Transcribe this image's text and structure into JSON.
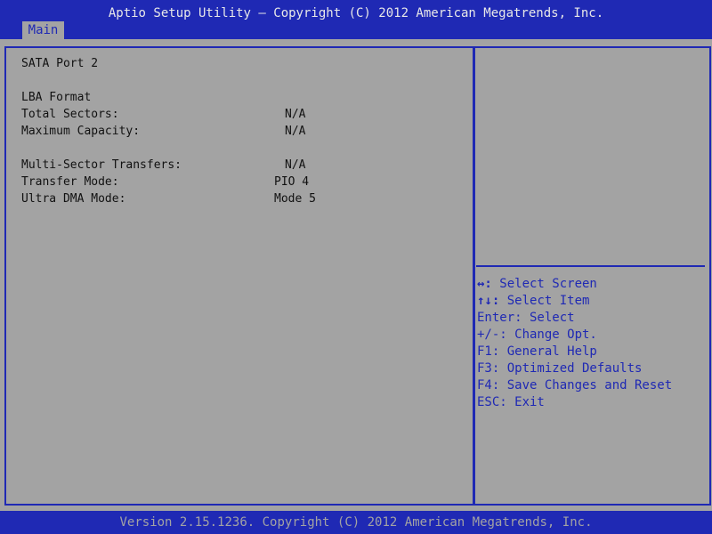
{
  "header": {
    "title": "Aptio Setup Utility – Copyright (C) 2012 American Megatrends, Inc.",
    "tabs": [
      {
        "label": "Main"
      }
    ]
  },
  "main": {
    "section_title": "SATA Port 2",
    "subsection_title": "LBA Format",
    "items": [
      {
        "label": "Total Sectors:",
        "value": "N/A"
      },
      {
        "label": "Maximum Capacity:",
        "value": "N/A"
      },
      {
        "label": "Multi-Sector Transfers:",
        "value": "N/A"
      },
      {
        "label": "Transfer Mode:",
        "value": "PIO 4"
      },
      {
        "label": "Ultra DMA Mode:",
        "value": "Mode 5"
      }
    ]
  },
  "help": {
    "items": [
      {
        "key": "↔:",
        "text": " Select Screen"
      },
      {
        "key": "↑↓:",
        "text": " Select Item"
      },
      {
        "key": "",
        "text": "Enter: Select"
      },
      {
        "key": "",
        "text": "+/-: Change Opt."
      },
      {
        "key": "",
        "text": "F1: General Help"
      },
      {
        "key": "",
        "text": "F3: Optimized Defaults"
      },
      {
        "key": "",
        "text": "F4: Save Changes and Reset"
      },
      {
        "key": "",
        "text": "ESC: Exit"
      }
    ]
  },
  "footer": {
    "text": "Version 2.15.1236. Copyright (C) 2012 American Megatrends, Inc."
  },
  "colors": {
    "primary_blue": "#1f29b4",
    "panel_gray": "#a3a3a3",
    "text_dark": "#111111",
    "header_text": "#e8e8e8"
  }
}
